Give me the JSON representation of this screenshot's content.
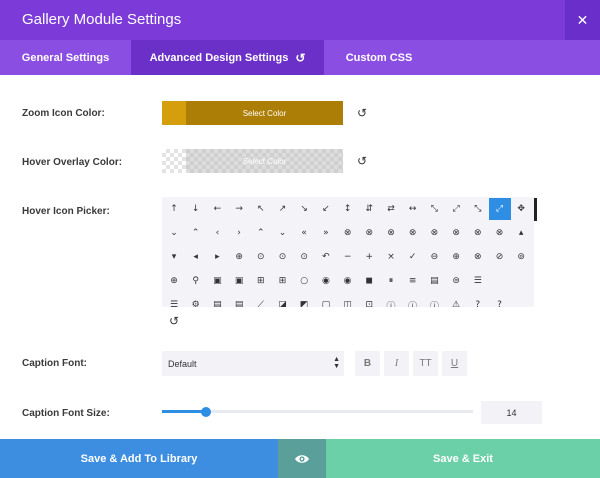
{
  "window": {
    "title": "Gallery Module Settings",
    "close_glyph": "✕"
  },
  "tabs": [
    {
      "label": "General Settings"
    },
    {
      "label": "Advanced Design Settings",
      "reset_glyph": "↺"
    },
    {
      "label": "Custom CSS"
    }
  ],
  "settings": {
    "zoom_icon_color": {
      "label": "Zoom Icon Color:",
      "button_text": "Select Color",
      "color": "#ad7e06"
    },
    "hover_overlay_color": {
      "label": "Hover Overlay Color:",
      "button_text": "Select Color"
    },
    "hover_icon_picker": {
      "label": "Hover Icon Picker:",
      "selected_icon": "expand-diagonal-icon",
      "rows": [
        [
          "↑",
          "↓",
          "←",
          "→",
          "↖",
          "↗",
          "↘",
          "↙",
          "↕",
          "⇵",
          "⇄",
          "↔",
          "⤡",
          "⤢",
          "⤡",
          "⤢",
          "✥"
        ],
        [
          "⌄",
          "⌃",
          "‹",
          "›",
          "⌃",
          "⌄",
          "«",
          "»",
          "⊗",
          "⊗",
          "⊗",
          "⊗",
          "⊗",
          "⊗",
          "⊗",
          "⊗",
          "▴"
        ],
        [
          "▾",
          "◂",
          "▸",
          "⊕",
          "⊙",
          "⊙",
          "⊙",
          "↶",
          "−",
          "+",
          "×",
          "✓",
          "⊖",
          "⊕",
          "⊗",
          "⊘",
          "⊚"
        ],
        [
          "⊕",
          "⚲",
          "▣",
          "▣",
          "⊞",
          "⊞",
          "○",
          "◉",
          "◉",
          "◼",
          "⏸",
          "≡",
          "▤",
          "⊜",
          "☰"
        ],
        [
          "☰",
          "⚙",
          "▤",
          "▤",
          "⟋",
          "◪",
          "◩",
          "▢",
          "◫",
          "⊡",
          "ⓘ",
          "ⓘ",
          "ⓘ",
          "⚠",
          "?",
          "?"
        ]
      ]
    },
    "caption_font": {
      "label": "Caption Font:",
      "selected": "Default",
      "styles": [
        {
          "key": "bold",
          "label": "B"
        },
        {
          "key": "italic",
          "label": "I"
        },
        {
          "key": "uppercase",
          "label": "TT"
        },
        {
          "key": "underline",
          "label": "U"
        }
      ]
    },
    "caption_font_size": {
      "label": "Caption Font Size:",
      "value": "14"
    }
  },
  "reset_glyph": "↺",
  "footer": {
    "save_library": "Save & Add To Library",
    "preview_icon": "eye-icon",
    "save_exit": "Save & Exit"
  },
  "colors": {
    "header": "#7c3bd9",
    "tabs": "#8a4ee3",
    "active_tab": "#6b30c8",
    "accent": "#2e8ee3",
    "save_library": "#3d8ee0",
    "save_exit": "#6bcfa8"
  }
}
